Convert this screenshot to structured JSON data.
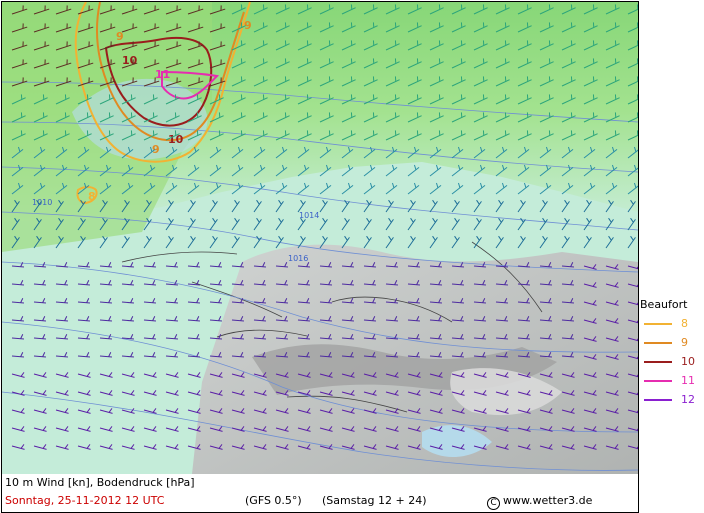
{
  "header": {
    "title": "10 m Wind [kn], Bodendruck [hPa]",
    "date": "Sonntag, 25-11-2012  12 UTC",
    "model": "(GFS 0.5°)",
    "run": "(Samstag 12 + 24)",
    "copyright_symbol": "C",
    "copyright_text": "www.wetter3.de"
  },
  "colors": {
    "beaufort_8": "#f2b233",
    "beaufort_9": "#e08a22",
    "beaufort_10": "#9a1d1d",
    "beaufort_11": "#e62cb0",
    "beaufort_12": "#8a1fd0",
    "sea_light_green": "#c4ecd9",
    "land_gray": "#bdbdbd",
    "isobar": "#6f8fd4",
    "barb_purple": "#5a1ea6"
  },
  "legend": {
    "title": "Beaufort",
    "items": [
      {
        "label": "8",
        "color_key": "beaufort_8"
      },
      {
        "label": "9",
        "color_key": "beaufort_9"
      },
      {
        "label": "10",
        "color_key": "beaufort_10"
      },
      {
        "label": "11",
        "color_key": "beaufort_11"
      },
      {
        "label": "12",
        "color_key": "beaufort_12"
      }
    ]
  },
  "map": {
    "isobar_labels": [
      "1010",
      "1014",
      "1016"
    ],
    "beaufort_contour_labels": [
      "9",
      "10",
      "11",
      "10",
      "9",
      "8",
      "9"
    ]
  }
}
